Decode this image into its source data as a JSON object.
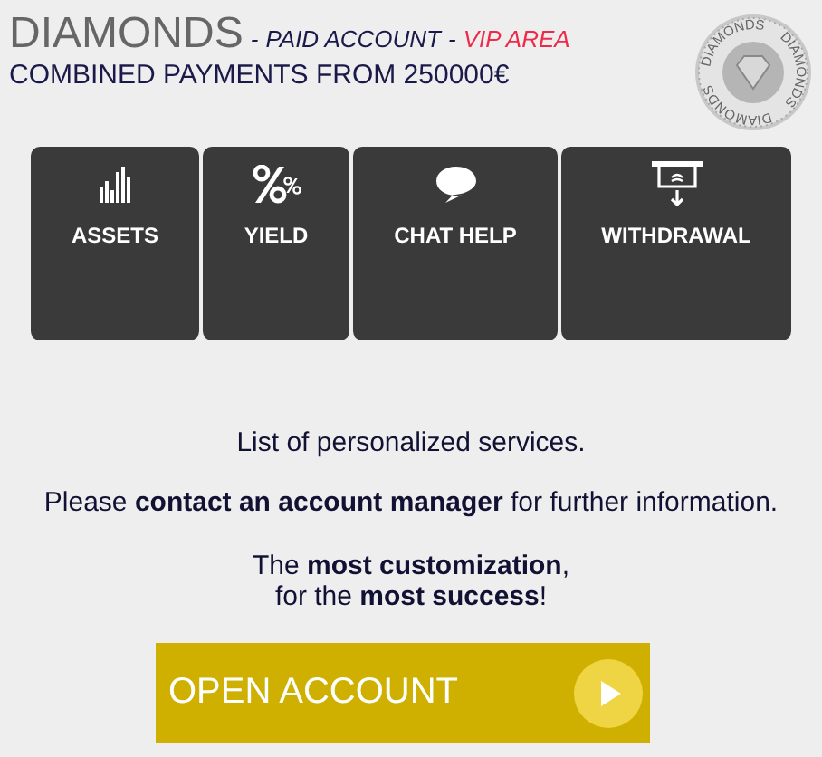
{
  "header": {
    "title": "DIAMONDS",
    "separator_1": "-",
    "account_type": "PAID ACCOUNT",
    "separator_2": "-",
    "area": "VIP AREA",
    "subtitle": "COMBINED PAYMENTS FROM 250000€"
  },
  "seal": {
    "texts": [
      "DIAMONDS",
      "DIAMONDS",
      "DIAMONDS"
    ]
  },
  "tiles": [
    {
      "label": "ASSETS",
      "kind": "chart"
    },
    {
      "label": "YIELD",
      "kind": "percent"
    },
    {
      "label": "CHAT HELP",
      "kind": "chat"
    },
    {
      "label": "WITHDRAWAL",
      "kind": "atm"
    }
  ],
  "intro": "List of personalized services.",
  "contact": "Please **contact an account manager** for further information.",
  "slogan": [
    "The **most customization**,",
    "for the **most success**!"
  ],
  "cta": {
    "label": "OPEN ACCOUNT"
  }
}
